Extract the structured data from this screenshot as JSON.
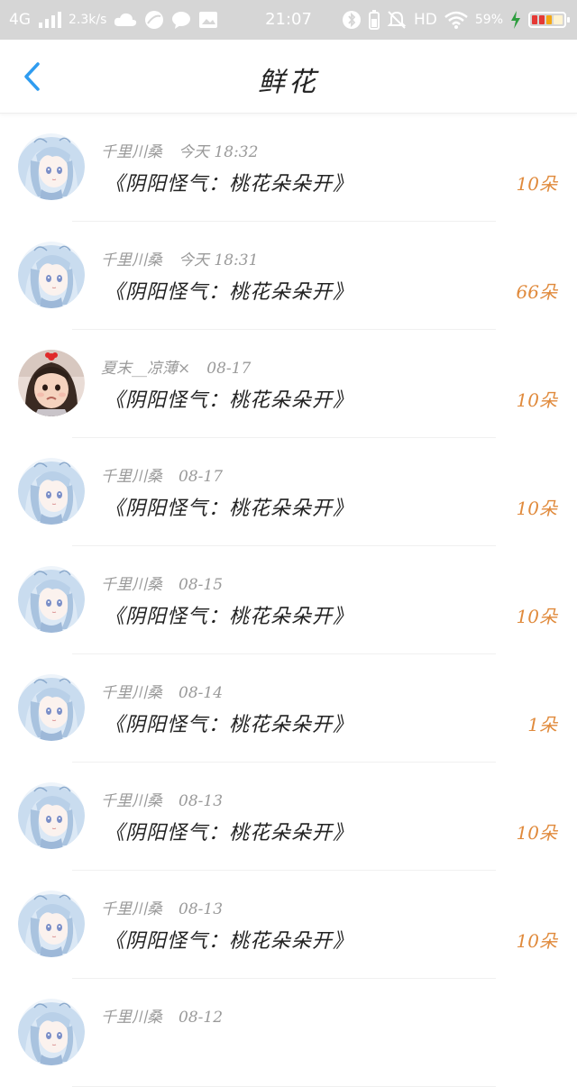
{
  "status_bar": {
    "network": "4G",
    "speed": "2.3k/s",
    "time": "21:07",
    "hd": "HD",
    "battery": "59%",
    "colors": {
      "bg": "#d6d6d6",
      "fg": "#ffffff",
      "battery_low": "#e53935"
    }
  },
  "nav": {
    "title": "鲜花",
    "back_icon": "chevron-left-icon",
    "colors": {
      "back": "#2f9cf0"
    }
  },
  "avatars": {
    "anime": "anime-girl-avatar",
    "baby": "baby-girl-avatar"
  },
  "list": [
    {
      "name": "千里川桑",
      "time": "今天 18:32",
      "gift": "《阴阳怪气：桃花朵朵开》",
      "amount": "10朵",
      "avatar": "anime"
    },
    {
      "name": "千里川桑",
      "time": "今天 18:31",
      "gift": "《阴阳怪气：桃花朵朵开》",
      "amount": "66朵",
      "avatar": "anime"
    },
    {
      "name": "夏末__凉薄×",
      "time": "08-17",
      "gift": "《阴阳怪气：桃花朵朵开》",
      "amount": "10朵",
      "avatar": "baby"
    },
    {
      "name": "千里川桑",
      "time": "08-17",
      "gift": "《阴阳怪气：桃花朵朵开》",
      "amount": "10朵",
      "avatar": "anime"
    },
    {
      "name": "千里川桑",
      "time": "08-15",
      "gift": "《阴阳怪气：桃花朵朵开》",
      "amount": "10朵",
      "avatar": "anime"
    },
    {
      "name": "千里川桑",
      "time": "08-14",
      "gift": "《阴阳怪气：桃花朵朵开》",
      "amount": "1朵",
      "avatar": "anime"
    },
    {
      "name": "千里川桑",
      "time": "08-13",
      "gift": "《阴阳怪气：桃花朵朵开》",
      "amount": "10朵",
      "avatar": "anime"
    },
    {
      "name": "千里川桑",
      "time": "08-13",
      "gift": "《阴阳怪气：桃花朵朵开》",
      "amount": "10朵",
      "avatar": "anime"
    },
    {
      "name": "千里川桑",
      "time": "08-12",
      "gift": "",
      "amount": "",
      "avatar": "anime"
    }
  ],
  "colors": {
    "amount": "#e08a3c",
    "meta": "#9a9a9a",
    "gift": "#222222"
  }
}
